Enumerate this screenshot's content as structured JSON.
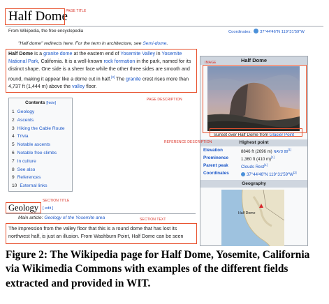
{
  "tags": {
    "page_title": "PAGE TITLE",
    "image": "IMAGE",
    "page_description": "PAGE DESCRIPTION",
    "reference_description": "REFERENCE DESCRIPTION",
    "section_title": "SECTION TITLE",
    "section_text": "SECTION TEXT"
  },
  "page": {
    "title": "Half Dome",
    "subtitle": "From Wikipedia, the free encyclopedia",
    "coordinates_label": "Coordinates:",
    "coordinates_value": "37°44′46″N 119°31′59″W",
    "hatnote_prefix": "\"Half dome\" redirects here. For the term in architecture, see ",
    "hatnote_link": "Semi-dome",
    "hatnote_suffix": "."
  },
  "lead": {
    "t1": "Half Dome",
    "t2": " is a ",
    "l1": "granite dome",
    "t3": " at the eastern end of ",
    "l2": "Yosemite Valley",
    "t4": " in ",
    "l3": "Yosemite National Park",
    "t5": ", California. It is a well-known ",
    "l4": "rock formation",
    "t6": " in the park, named for its distinct shape. One side is a sheer face while the other three sides are smooth and round, making it appear like a dome cut in half.",
    "ref": "[3]",
    "t7": " The ",
    "l5": "granite",
    "t8": " crest rises more than 4,737 ft (1,444 m) above the ",
    "l6": "valley",
    "t9": " floor."
  },
  "toc": {
    "title": "Contents",
    "hide": "[hide]",
    "items": [
      {
        "num": "1",
        "label": "Geology"
      },
      {
        "num": "2",
        "label": "Ascents"
      },
      {
        "num": "3",
        "label": "Hiking the Cable Route"
      },
      {
        "num": "4",
        "label": "Trivia"
      },
      {
        "num": "5",
        "label": "Notable ascents"
      },
      {
        "num": "6",
        "label": "Notable free climbs"
      },
      {
        "num": "7",
        "label": "In culture"
      },
      {
        "num": "8",
        "label": "See also"
      },
      {
        "num": "9",
        "label": "References"
      },
      {
        "num": "10",
        "label": "External links"
      }
    ]
  },
  "infobox": {
    "title": "Half Dome",
    "image_caption_prefix": "Sunset over Half Dome from ",
    "image_caption_link": "Glacier Point",
    "highest_point": "Highest point",
    "rows": [
      {
        "label": "Elevation",
        "value": "8846 ft (2696 m)",
        "extra": "NAVD 88",
        "ref": "[1]"
      },
      {
        "label": "Prominence",
        "value": "1,360 ft (410 m)",
        "extra": "",
        "ref": "[1]"
      },
      {
        "label": "Parent peak",
        "value": "Clouds Rest",
        "extra": "",
        "ref": "[1]"
      },
      {
        "label": "Coordinates",
        "value": "37°44′46″N 119°31′59″W",
        "extra": "",
        "ref": "[2]"
      }
    ],
    "geography": "Geography",
    "map_label": "Half Dome"
  },
  "section": {
    "title": "Geology",
    "edit": "[ edit ]",
    "main_article_prefix": "Main article: ",
    "main_article_link": "Geology of the Yosemite area",
    "text": "The impression from the valley floor that this is a round dome that has lost its northwest half, is just an illusion. From Washburn Point, Half Dome can be seen"
  },
  "figure_caption": "Figure 2: The Wikipedia page for Half Dome, Yosemite, California via Wikimedia Commons with examples of the different fields extracted and provided in WIT."
}
